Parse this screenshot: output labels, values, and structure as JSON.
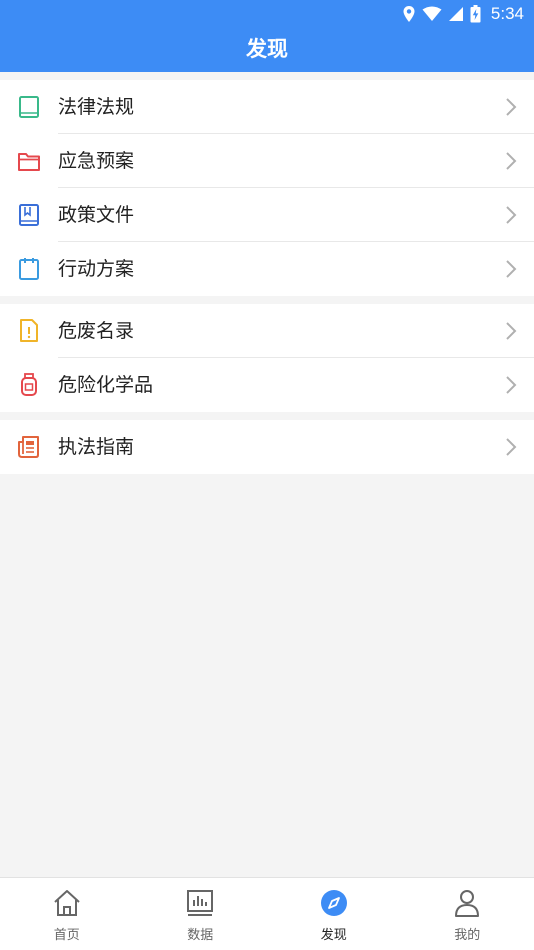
{
  "status_bar": {
    "time": "5:34",
    "icons": [
      "location-icon",
      "wifi-icon",
      "signal-icon",
      "battery-charging-icon"
    ]
  },
  "header": {
    "title": "发现"
  },
  "groups": [
    {
      "items": [
        {
          "label": "法律法规",
          "icon": "book-icon",
          "color": "#39b98a"
        },
        {
          "label": "应急预案",
          "icon": "folder-icon",
          "color": "#e5484d"
        },
        {
          "label": "政策文件",
          "icon": "bookmark-document-icon",
          "color": "#3a6fd8"
        },
        {
          "label": "行动方案",
          "icon": "clipboard-icon",
          "color": "#3a9be0"
        }
      ]
    },
    {
      "items": [
        {
          "label": "危废名录",
          "icon": "hazard-file-icon",
          "color": "#f0b429"
        },
        {
          "label": "危险化学品",
          "icon": "chemical-bottle-icon",
          "color": "#e5484d"
        }
      ]
    },
    {
      "items": [
        {
          "label": "执法指南",
          "icon": "newspaper-icon",
          "color": "#e2643c"
        }
      ]
    }
  ],
  "tabbar": {
    "tabs": [
      {
        "label": "首页",
        "icon": "home-icon",
        "active": false
      },
      {
        "label": "数据",
        "icon": "bar-chart-icon",
        "active": false
      },
      {
        "label": "发现",
        "icon": "compass-icon",
        "active": true
      },
      {
        "label": "我的",
        "icon": "user-icon",
        "active": false
      }
    ]
  },
  "colors": {
    "primary": "#3d8cf5",
    "background": "#f4f4f4",
    "chevron": "#b0b0b0"
  }
}
